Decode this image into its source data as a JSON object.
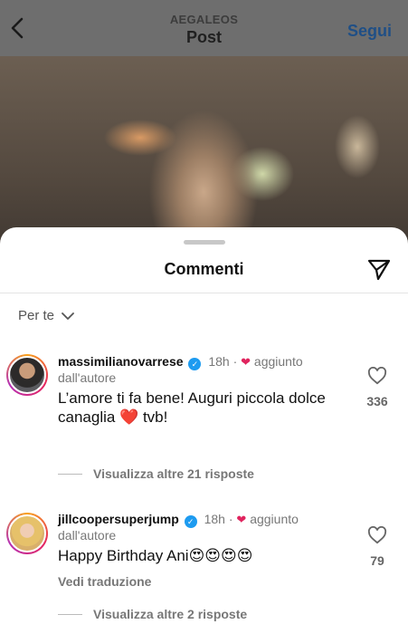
{
  "header": {
    "subtitle": "AEGALEOS",
    "title": "Post",
    "follow_label": "Segui"
  },
  "sheet": {
    "title": "Commenti",
    "sort_label": "Per te"
  },
  "comments": [
    {
      "username": "massimilianovarrese",
      "time": "18h",
      "liked_label": "aggiunto",
      "liked_by": "dall'autore",
      "text": "L’amore ti fa bene! Auguri piccola dolce canaglia ❤️ tvb!",
      "likes": "336",
      "replies_label": "Visualizza altre 21 risposte"
    },
    {
      "username": "jillcoopersuperjump",
      "time": "18h",
      "liked_label": "aggiunto",
      "liked_by": "dall'autore",
      "text": "Happy Birthday Ani😍😍😍😍",
      "likes": "79",
      "translate_label": "Vedi traduzione",
      "replies_label": "Visualizza altre 2 risposte"
    }
  ],
  "icons": {
    "back": "chevron-left-icon",
    "share": "paper-plane-icon",
    "like": "heart-outline-icon",
    "verified": "verified-badge-icon",
    "sort": "chevron-down-icon"
  },
  "colors": {
    "accent": "#1d9bf0",
    "heart": "#e0245e",
    "follow": "#1f4f86"
  }
}
